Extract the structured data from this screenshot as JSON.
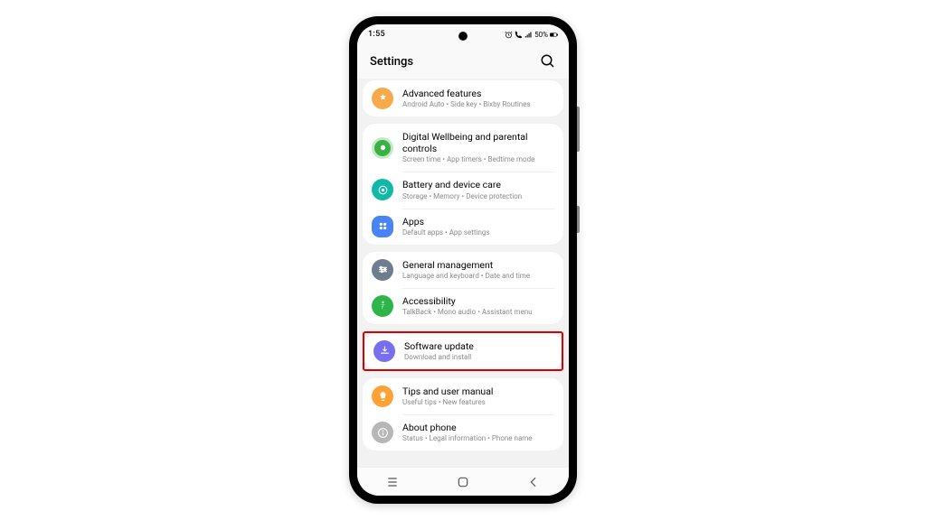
{
  "status": {
    "time": "1:55",
    "battery_text": "50%"
  },
  "header": {
    "title": "Settings"
  },
  "groups": [
    {
      "items": [
        {
          "title": "Advanced features",
          "subtitle": "Android Auto  •  Side key  •  Bixby Routines"
        }
      ]
    },
    {
      "items": [
        {
          "title": "Digital Wellbeing and parental controls",
          "subtitle": "Screen time  •  App timers  •  Bedtime mode"
        },
        {
          "title": "Battery and device care",
          "subtitle": "Storage  •  Memory  •  Device protection"
        },
        {
          "title": "Apps",
          "subtitle": "Default apps  •  App settings"
        }
      ]
    },
    {
      "items": [
        {
          "title": "General management",
          "subtitle": "Language and keyboard  •  Date and time"
        },
        {
          "title": "Accessibility",
          "subtitle": "TalkBack  •  Mono audio  •  Assistant menu"
        }
      ]
    },
    {
      "highlighted": true,
      "items": [
        {
          "title": "Software update",
          "subtitle": "Download and install"
        }
      ]
    },
    {
      "items": [
        {
          "title": "Tips and user manual",
          "subtitle": "Useful tips  •  New features"
        },
        {
          "title": "About phone",
          "subtitle": "Status  •  Legal information  •  Phone name"
        }
      ]
    }
  ]
}
